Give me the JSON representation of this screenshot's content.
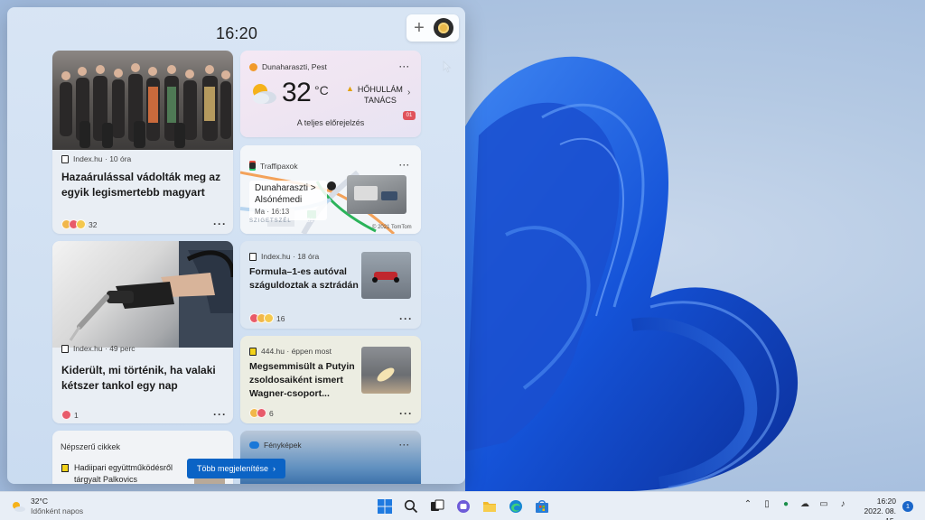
{
  "panel": {
    "clock": "16:20"
  },
  "weather": {
    "location": "Dunaharaszti, Pest",
    "temp": "32",
    "unit": "°C",
    "alert": "HŐHULLÁM TANÁCS",
    "alert_line1": "HŐHULLÁM",
    "alert_line2": "TANÁCS",
    "forecast_link": "A teljes előrejelzés",
    "badge": "01"
  },
  "traffic": {
    "title": "Traffipaxok",
    "route_line1": "Dunaharaszti >",
    "route_line2": "Alsónémedi",
    "time": "Ma · 16:13",
    "map_label": "SZIGETSZÉL",
    "road_number": "51",
    "copyright": "© 2021 TomTom"
  },
  "news": [
    {
      "source": "Index.hu",
      "age": "10 óra",
      "headline": "Hazaárulással vádolták meg az egyik legismertebb magyart",
      "reactions": "32",
      "colors": [
        "#f1b74a",
        "#e85b6a",
        "#f4c84e"
      ]
    },
    {
      "source": "Index.hu",
      "age": "49 perc",
      "headline": "Kiderült, mi történik, ha valaki kétszer tankol egy nap",
      "reactions": "1",
      "colors": [
        "#e85b6a"
      ]
    },
    {
      "source": "Index.hu",
      "age": "18 óra",
      "headline": "Formula–1-es autóval száguldoztak a sztrádán",
      "reactions": "16",
      "colors": [
        "#e85b6a",
        "#f1b74a",
        "#f4c84e"
      ]
    },
    {
      "source": "444.hu",
      "age": "éppen most",
      "headline": "Megsemmisült a Putyin zsoldosaiként ismert Wagner-csoport...",
      "reactions": "6",
      "colors": [
        "#f1b74a",
        "#e85b6a"
      ]
    }
  ],
  "popular": {
    "title": "Népszerű cikkek",
    "item": "Hadiipari együttműködésről tárgyalt Palkovics"
  },
  "photos": {
    "title": "Fényképek"
  },
  "more_button": "Több megjelenítése",
  "taskbar": {
    "weather_temp": "32°C",
    "weather_desc": "Időnként napos",
    "time": "16:20",
    "date": "2022. 08. 15.",
    "notifications": "1"
  },
  "colors": {
    "accent": "#0b63c5",
    "wallpaper_blue": "#1d5fe0"
  }
}
